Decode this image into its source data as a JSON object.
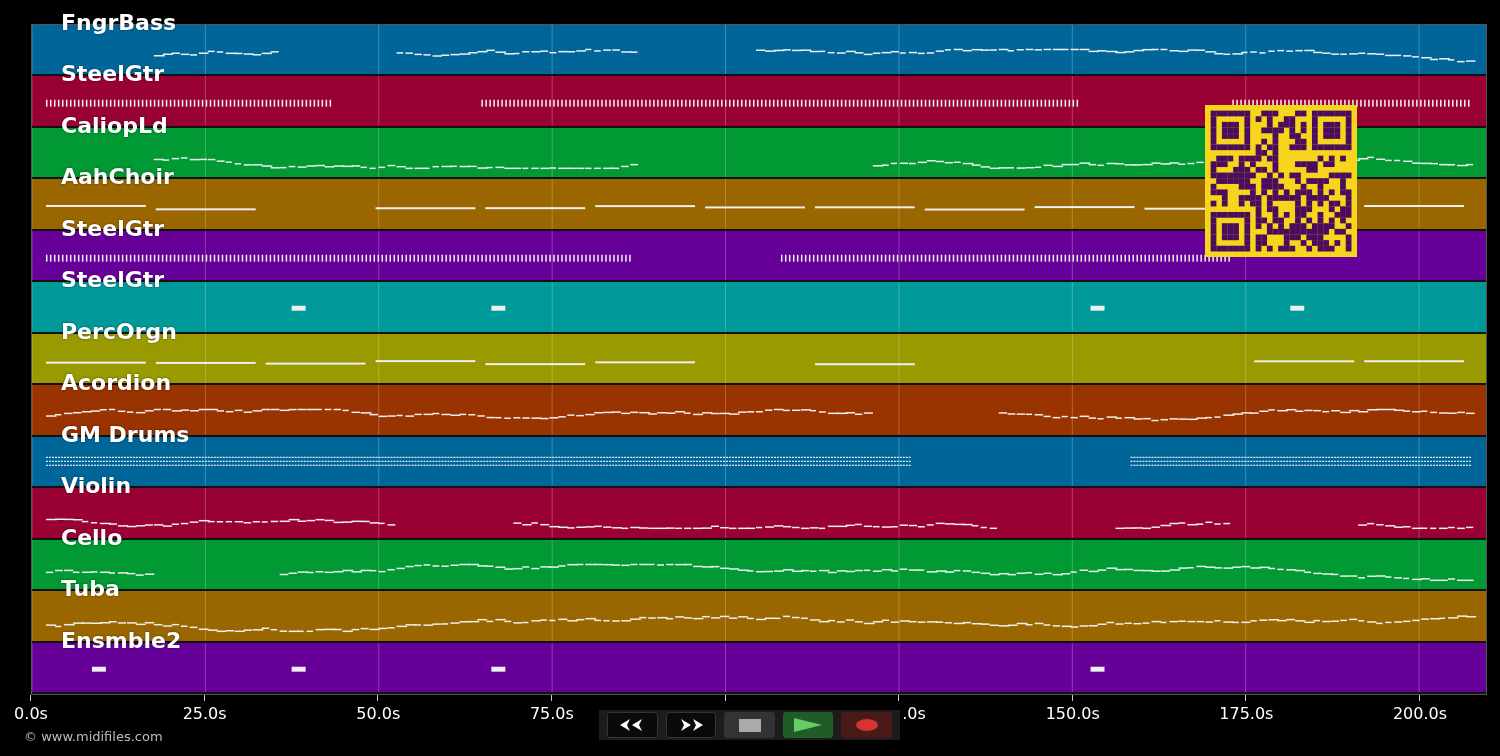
{
  "tracks": [
    {
      "name": "FngrBass",
      "color": "#006699",
      "kind": "melody"
    },
    {
      "name": "SteelGtr",
      "color": "#990033",
      "kind": "chords"
    },
    {
      "name": "CaliopLd",
      "color": "#009933",
      "kind": "melody"
    },
    {
      "name": "AahChoir",
      "color": "#996600",
      "kind": "sustain"
    },
    {
      "name": "SteelGtr",
      "color": "#660099",
      "kind": "chords"
    },
    {
      "name": "SteelGtr",
      "color": "#009999",
      "kind": "sparse"
    },
    {
      "name": "PercOrgn",
      "color": "#999900",
      "kind": "sustain"
    },
    {
      "name": "Acordion",
      "color": "#993300",
      "kind": "melody"
    },
    {
      "name": "GM Drums",
      "color": "#006699",
      "kind": "drums"
    },
    {
      "name": "Violin",
      "color": "#990033",
      "kind": "melody"
    },
    {
      "name": "Cello",
      "color": "#009933",
      "kind": "melody"
    },
    {
      "name": "Tuba",
      "color": "#996600",
      "kind": "melody"
    },
    {
      "name": "Ensmble2",
      "color": "#660099",
      "kind": "sparse"
    }
  ],
  "timeline": {
    "labels": [
      "0.0s",
      "25.0s",
      "50.0s",
      "75.0s",
      ".0s",
      "150.0s",
      "175.0s",
      "200.0s"
    ]
  },
  "transport": [
    {
      "kind": "rewind"
    },
    {
      "kind": "forward"
    },
    {
      "kind": "stop"
    },
    {
      "kind": "play"
    },
    {
      "kind": "record"
    }
  ],
  "copyright": "© www.midifiles.com"
}
